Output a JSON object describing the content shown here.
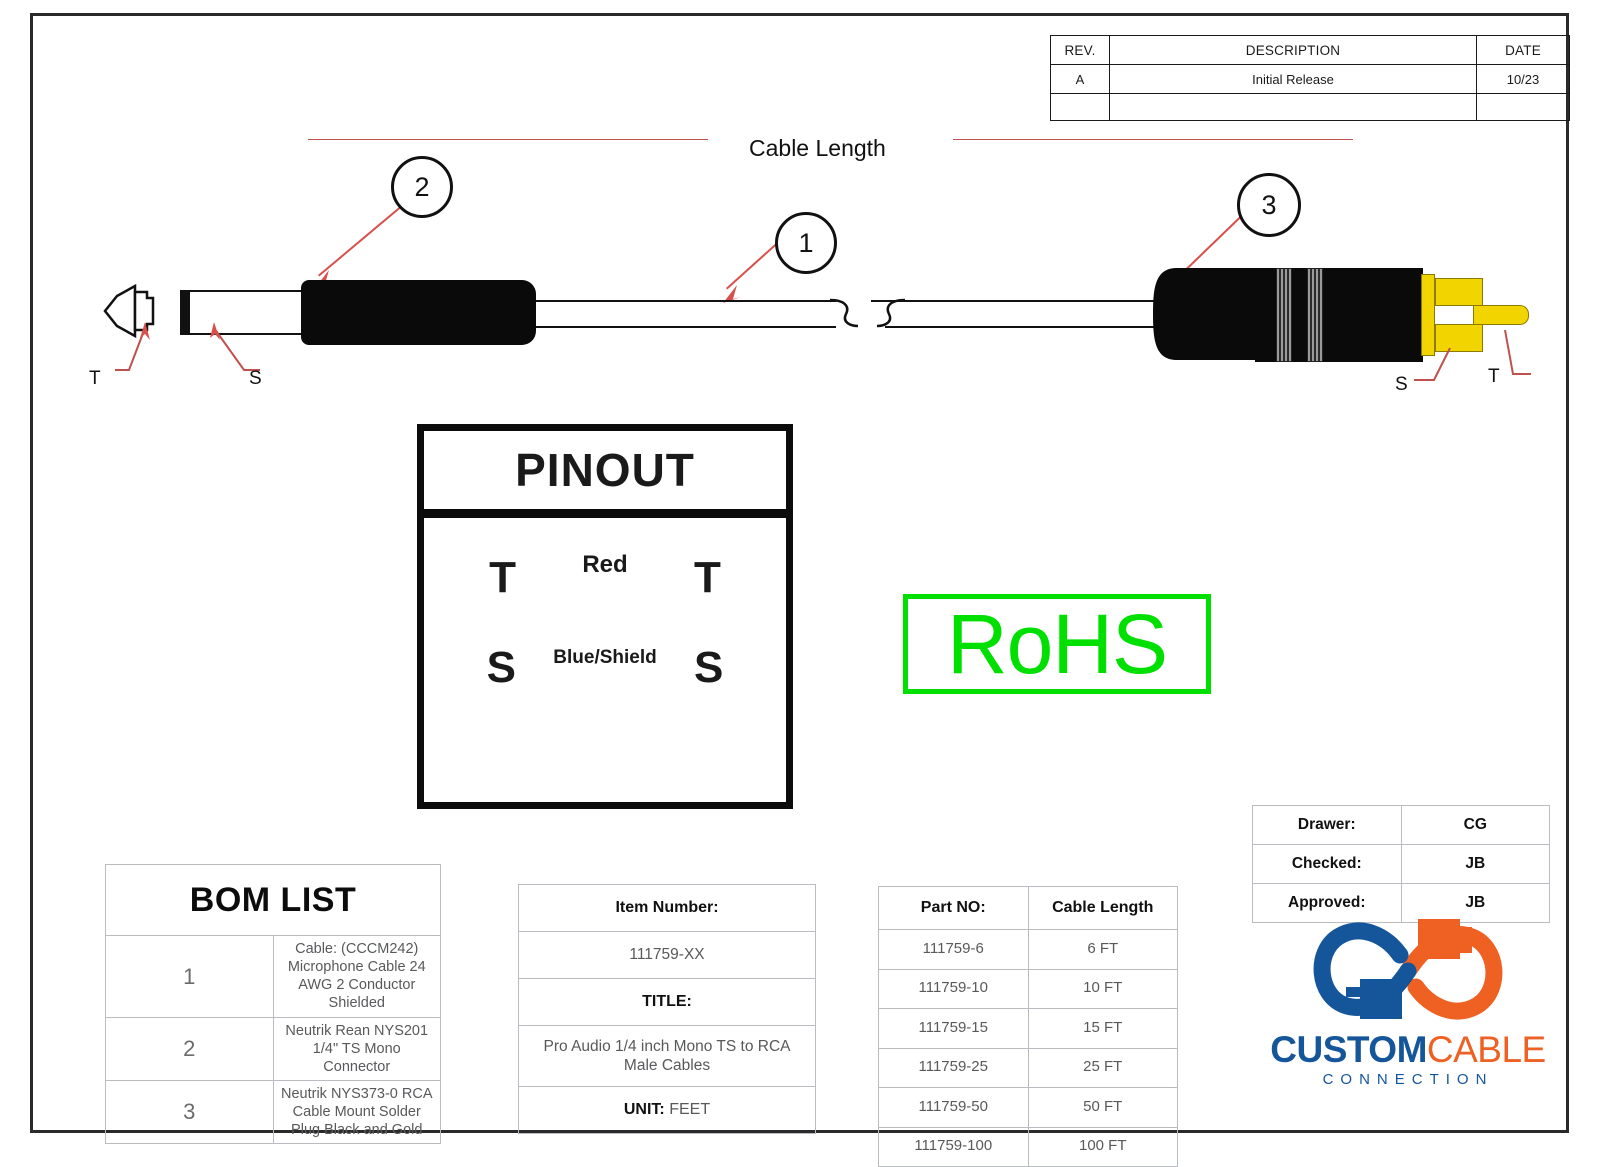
{
  "revision_table": {
    "headers": [
      "REV.",
      "DESCRIPTION",
      "DATE"
    ],
    "rows": [
      {
        "rev": "A",
        "description": "Initial Release",
        "date": "10/23"
      },
      {
        "rev": "",
        "description": "",
        "date": ""
      }
    ]
  },
  "drawing": {
    "cable_length_label": "Cable Length",
    "balloons": [
      {
        "number": "1"
      },
      {
        "number": "2"
      },
      {
        "number": "3"
      }
    ],
    "left_connector_labels": {
      "tip": "T",
      "sleeve": "S"
    },
    "right_connector_labels": {
      "sleeve": "S",
      "tip": "T"
    }
  },
  "pinout": {
    "title": "PINOUT",
    "rows": [
      {
        "left": "T",
        "wire": "Red",
        "right": "T"
      },
      {
        "left": "S",
        "wire": "Blue/Shield",
        "right": "S"
      }
    ]
  },
  "compliance": {
    "rohs_label": "RoHS",
    "rohs_color": "#00E000"
  },
  "bom": {
    "title": "BOM LIST",
    "rows": [
      {
        "num": "1",
        "desc": "Cable: (CCCM242) Microphone Cable 24 AWG 2 Conductor Shielded"
      },
      {
        "num": "2",
        "desc": "Neutrik Rean NYS201 1/4\" TS Mono Connector"
      },
      {
        "num": "3",
        "desc": "Neutrik NYS373-0 RCA Cable Mount Solder Plug Black and Gold"
      }
    ]
  },
  "item_block": {
    "item_number_label": "Item Number:",
    "item_number_value": "111759-XX",
    "title_label": "TITLE:",
    "title_value": "Pro Audio 1/4 inch Mono TS to RCA Male Cables",
    "unit_label": "UNIT:",
    "unit_value": "FEET"
  },
  "part_table": {
    "headers": [
      "Part NO:",
      "Cable Length"
    ],
    "rows": [
      {
        "part": "111759-6",
        "length": "6 FT"
      },
      {
        "part": "111759-10",
        "length": "10 FT"
      },
      {
        "part": "111759-15",
        "length": "15 FT"
      },
      {
        "part": "111759-25",
        "length": "25 FT"
      },
      {
        "part": "111759-50",
        "length": "50 FT"
      },
      {
        "part": "111759-100",
        "length": "100 FT"
      }
    ]
  },
  "approval": {
    "rows": [
      {
        "label": "Drawer:",
        "value": "CG"
      },
      {
        "label": "Checked:",
        "value": "JB"
      },
      {
        "label": "Approved:",
        "value": "JB"
      }
    ]
  },
  "logo": {
    "word1": "CUSTOM",
    "word2": "CABLE",
    "tagline": "CONNECTION",
    "blue": "#15559A",
    "orange": "#EE6123"
  }
}
